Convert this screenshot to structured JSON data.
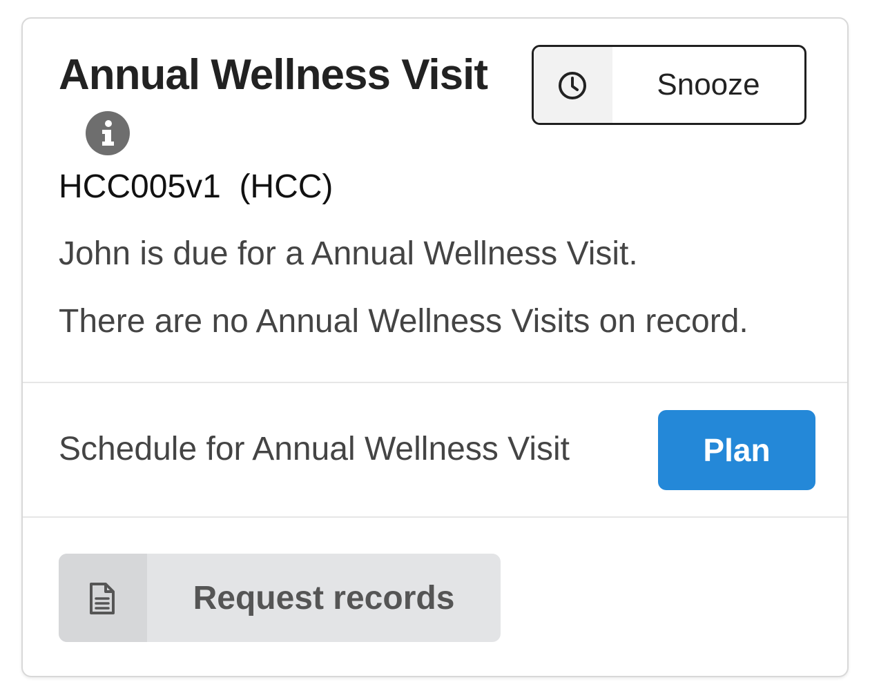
{
  "card": {
    "title": "Annual Wellness Visit",
    "info_icon": "info-circle-icon",
    "code": "HCC005v1  (HCC)",
    "description_1": "John is due for a Annual Wellness Visit.",
    "description_2": "There are no Annual Wellness Visits on record."
  },
  "snooze": {
    "icon": "clock-icon",
    "label": "Snooze"
  },
  "schedule": {
    "label": "Schedule for Annual Wellness Visit",
    "plan_label": "Plan"
  },
  "request": {
    "icon": "document-icon",
    "label": "Request records"
  },
  "colors": {
    "accent": "#2488d8",
    "title_text": "#222222",
    "body_text": "#444444",
    "info_icon": "#6e6e6e",
    "request_bg": "#e3e4e6"
  }
}
